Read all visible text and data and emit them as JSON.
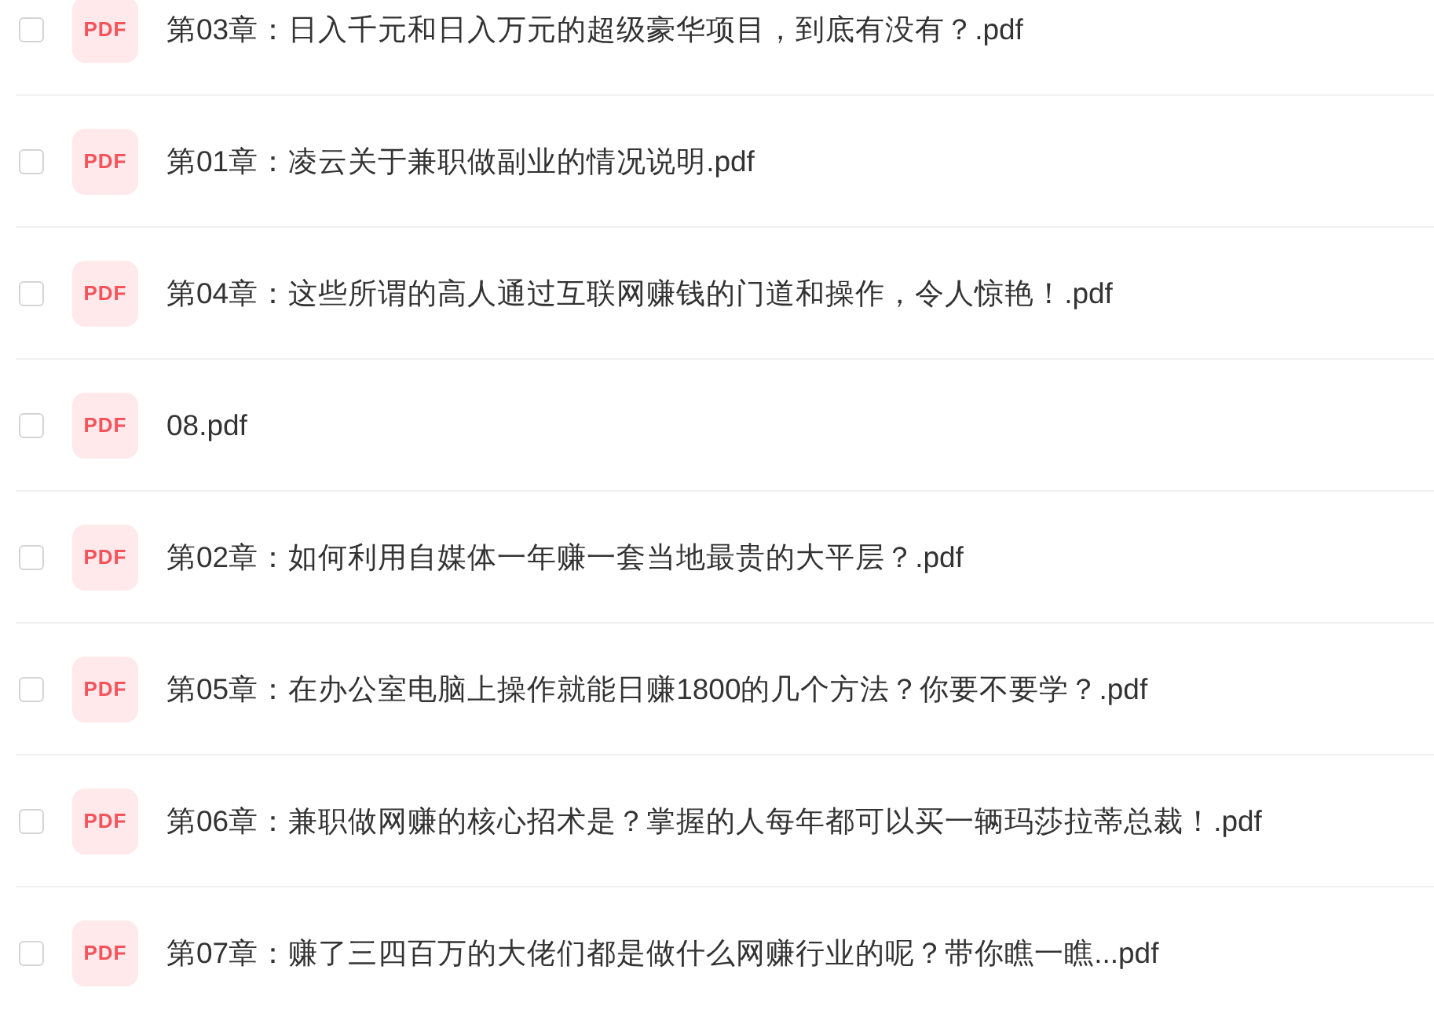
{
  "files": [
    {
      "checked": false,
      "badge": "PDF",
      "name": "第03章：日入千元和日入万元的超级豪华项目，到底有没有？.pdf"
    },
    {
      "checked": false,
      "badge": "PDF",
      "name": "第01章：凌云关于兼职做副业的情况说明.pdf"
    },
    {
      "checked": false,
      "badge": "PDF",
      "name": "第04章：这些所谓的高人通过互联网赚钱的门道和操作，令人惊艳！.pdf"
    },
    {
      "checked": false,
      "badge": "PDF",
      "name": "08.pdf"
    },
    {
      "checked": false,
      "badge": "PDF",
      "name": "第02章：如何利用自媒体一年赚一套当地最贵的大平层？.pdf"
    },
    {
      "checked": false,
      "badge": "PDF",
      "name": "第05章：在办公室电脑上操作就能日赚1800的几个方法？你要不要学？.pdf"
    },
    {
      "checked": false,
      "badge": "PDF",
      "name": "第06章：兼职做网赚的核心招术是？掌握的人每年都可以买一辆玛莎拉蒂总裁！.pdf"
    },
    {
      "checked": false,
      "badge": "PDF",
      "name": "第07章：赚了三四百万的大佬们都是做什么网赚行业的呢？带你瞧一瞧...pdf"
    }
  ]
}
